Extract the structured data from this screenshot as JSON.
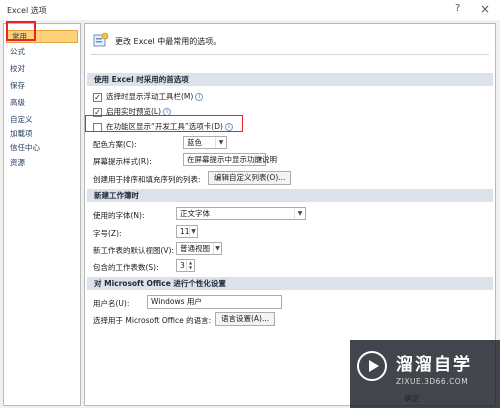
{
  "window": {
    "title": "Excel 选项",
    "help": "?",
    "close": "×"
  },
  "sidebar": {
    "items": [
      "常用",
      "公式",
      "校对",
      "保存",
      "高级",
      "自定义",
      "加载项",
      "信任中心",
      "资源"
    ]
  },
  "header": {
    "text": "更改 Excel 中最常用的选项。"
  },
  "sections": {
    "top": "使用 Excel 时采用的首选项",
    "workbook": "新建工作簿时",
    "personalize": "对 Microsoft Office 进行个性化设置"
  },
  "options": {
    "mini_toolbar": {
      "label": "选择时显示浮动工具栏(M)",
      "checked": "✓"
    },
    "live_preview": {
      "label": "启用实时预览(L)",
      "checked": "✓"
    },
    "developer_tab": {
      "label": "在功能区显示“开发工具”选项卡(D)",
      "checked": ""
    },
    "color_scheme": {
      "label": "配色方案(C):",
      "value": "蓝色"
    },
    "screentip": {
      "label": "屏幕提示样式(R):",
      "value": "在屏幕提示中显示功能说明"
    },
    "custom_lists": {
      "label": "创建用于排序和填充序列的列表:",
      "button": "编辑自定义列表(O)..."
    }
  },
  "workbook": {
    "font": {
      "label": "使用的字体(N):",
      "value": "正文字体"
    },
    "size": {
      "label": "字号(Z):",
      "value": "11"
    },
    "default_view": {
      "label": "新工作表的默认视图(V):",
      "value": "普通视图"
    },
    "sheets": {
      "label": "包含的工作表数(S):",
      "value": "3"
    }
  },
  "personalize": {
    "username": {
      "label": "用户名(U):",
      "value": "Windows 用户"
    },
    "language": {
      "label": "选择用于 Microsoft Office 的语言:",
      "button": "语言设置(A)..."
    }
  },
  "footer": {
    "ok": "确定"
  },
  "watermark": {
    "title": "溜溜自学",
    "url": "ZIXUE.3D66.COM"
  }
}
